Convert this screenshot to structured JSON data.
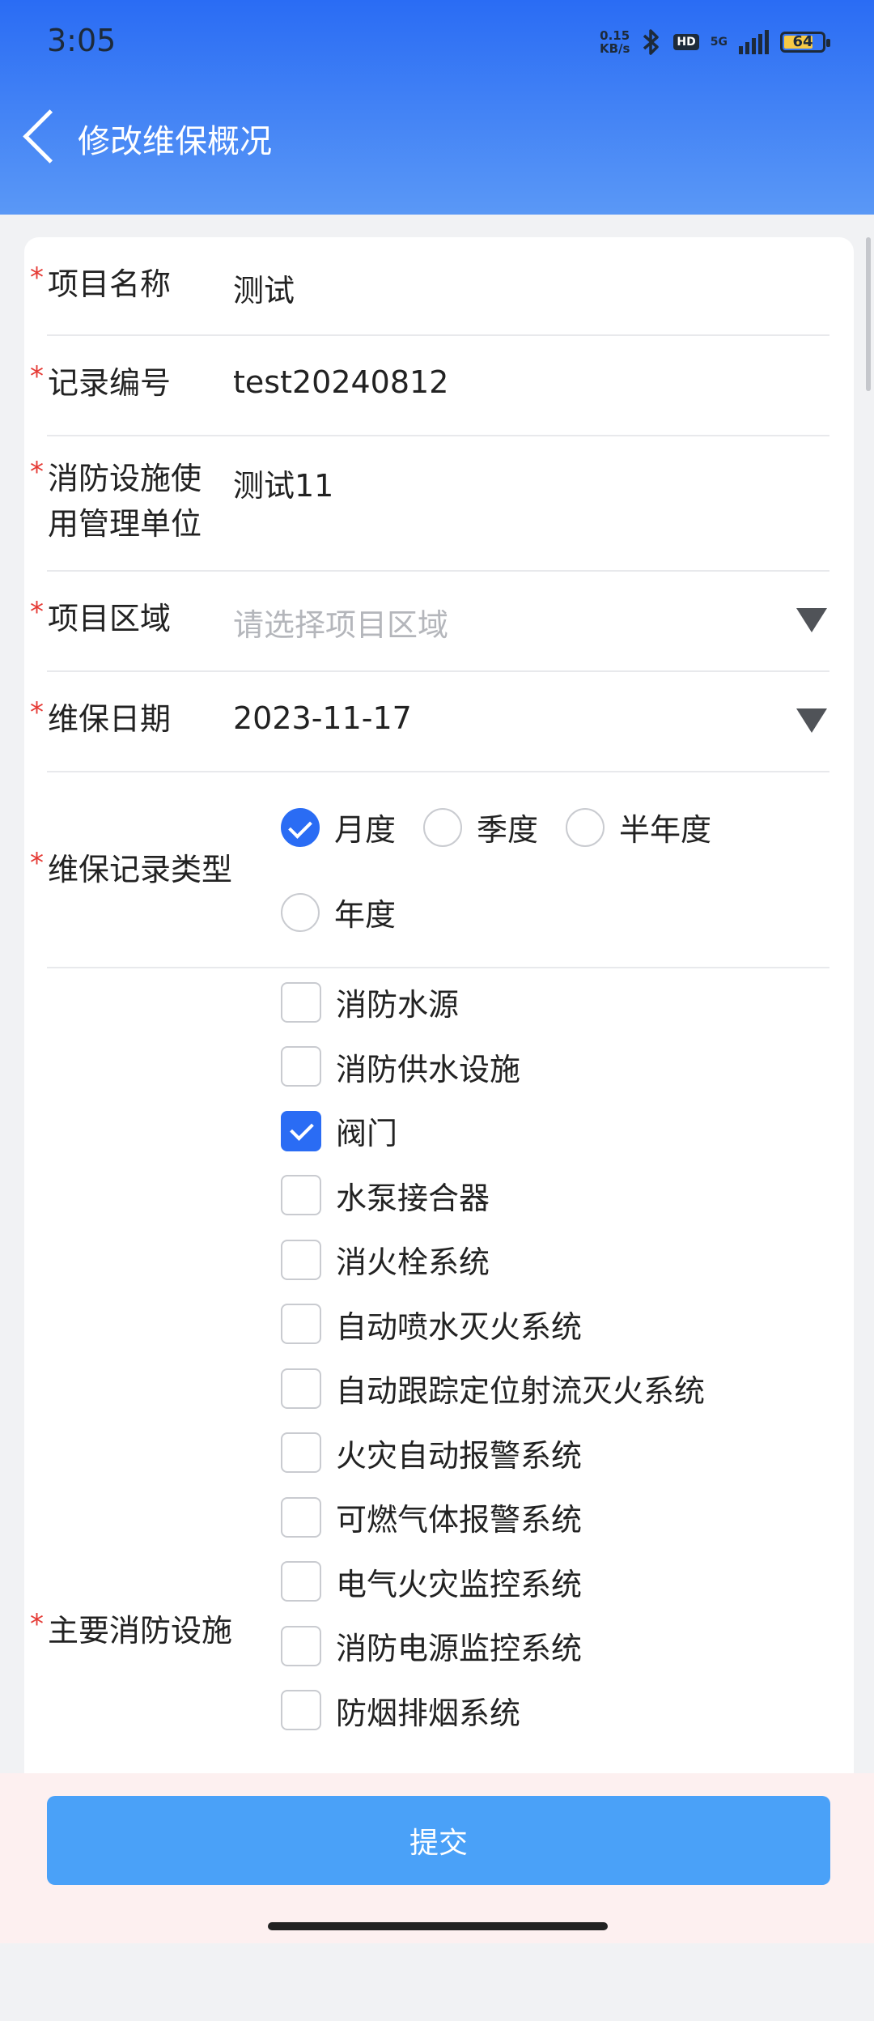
{
  "status_bar": {
    "time": "3:05",
    "net_speed_value": "0.15",
    "net_speed_unit": "KB/s",
    "hd": "HD",
    "network": "5G",
    "battery": "64",
    "icons": [
      "bluetooth-icon",
      "signal-icon",
      "battery-icon"
    ]
  },
  "header": {
    "title": "修改维保概况",
    "back_icon": "chevron-left-icon"
  },
  "form": {
    "required_mark": "*",
    "project_name": {
      "label": "项目名称",
      "value": "测试"
    },
    "record_no": {
      "label": "记录编号",
      "value": "test20240812"
    },
    "management_unit": {
      "label_line1": "消防设施使",
      "label_line2": "用管理单位",
      "value": "测试11"
    },
    "project_area": {
      "label": "项目区域",
      "placeholder": "请选择项目区域"
    },
    "maintenance_date": {
      "label": "维保日期",
      "value": "2023-11-17"
    },
    "record_type": {
      "label": "维保记录类型",
      "options": [
        {
          "label": "月度",
          "selected": true
        },
        {
          "label": "季度",
          "selected": false
        },
        {
          "label": "半年度",
          "selected": false
        },
        {
          "label": "年度",
          "selected": false
        }
      ]
    },
    "main_facilities": {
      "label": "主要消防设施",
      "options": [
        {
          "label": "消防水源",
          "checked": false
        },
        {
          "label": "消防供水设施",
          "checked": false
        },
        {
          "label": "阀门",
          "checked": true
        },
        {
          "label": "水泵接合器",
          "checked": false
        },
        {
          "label": "消火栓系统",
          "checked": false
        },
        {
          "label": "自动喷水灭火系统",
          "checked": false
        },
        {
          "label": "自动跟踪定位射流灭火系统",
          "checked": false
        },
        {
          "label": "火灾自动报警系统",
          "checked": false
        },
        {
          "label": "可燃气体报警系统",
          "checked": false
        },
        {
          "label": "电气火灾监控系统",
          "checked": false
        },
        {
          "label": "消防电源监控系统",
          "checked": false
        },
        {
          "label": "防烟排烟系统",
          "checked": false
        }
      ]
    }
  },
  "submit_label": "提交",
  "colors": {
    "primary": "#2a6cf4",
    "submit": "#4aa1f8",
    "required": "#e53a35"
  }
}
